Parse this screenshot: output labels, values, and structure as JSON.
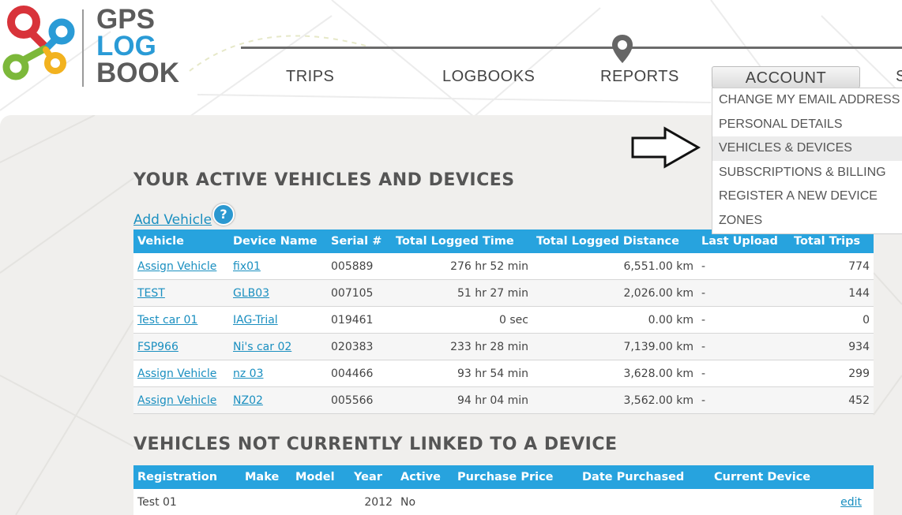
{
  "logo": {
    "line1": "GPS",
    "line2": "LOG",
    "line3": "BOOK"
  },
  "nav": {
    "trips": "TRIPS",
    "logbooks": "LOGBOOKS",
    "reports": "REPORTS",
    "account": "ACCOUNT",
    "partial": "S"
  },
  "account_menu": {
    "items": [
      "CHANGE MY EMAIL ADDRESS",
      "PERSONAL DETAILS",
      "VEHICLES & DEVICES",
      "SUBSCRIPTIONS & BILLING",
      "REGISTER A NEW DEVICE",
      "ZONES"
    ],
    "active_index": 2
  },
  "active_section": {
    "title": "YOUR ACTIVE VEHICLES AND DEVICES",
    "add_vehicle": "Add Vehicle",
    "help_icon": "?",
    "columns": [
      "Vehicle",
      "Device Name",
      "Serial #",
      "Total Logged Time",
      "Total Logged Distance",
      "Last Upload",
      "Total Trips"
    ],
    "rows": [
      [
        "Assign Vehicle",
        "fix01",
        "005889",
        "276 hr 52 min",
        "6,551.00 km",
        "-",
        "774"
      ],
      [
        "TEST",
        "GLB03",
        "007105",
        "51 hr 27 min",
        "2,026.00 km",
        "-",
        "144"
      ],
      [
        "Test car 01",
        "IAG-Trial",
        "019461",
        "0 sec",
        "0.00 km",
        "-",
        "0"
      ],
      [
        "FSP966",
        "Ni's car 02",
        "020383",
        "233 hr 28 min",
        "7,139.00 km",
        "-",
        "934"
      ],
      [
        "Assign Vehicle",
        "nz 03",
        "004466",
        "93 hr 54 min",
        "3,628.00 km",
        "-",
        "299"
      ],
      [
        "Assign Vehicle",
        "NZ02",
        "005566",
        "94 hr 04 min",
        "3,562.00 km",
        "-",
        "452"
      ]
    ]
  },
  "unlinked_section": {
    "title": "VEHICLES NOT CURRENTLY LINKED TO A DEVICE",
    "columns": [
      "Registration",
      "Make",
      "Model",
      "Year",
      "Active",
      "Purchase Price",
      "Date Purchased",
      "Current Device",
      ""
    ],
    "rows": [
      [
        "Test 01",
        "",
        "",
        "2012",
        "No",
        "",
        "",
        "",
        "edit"
      ]
    ]
  },
  "colors": {
    "accent": "#27a3de",
    "link": "#1a8fc0",
    "panel_bg": "#f0efed"
  }
}
